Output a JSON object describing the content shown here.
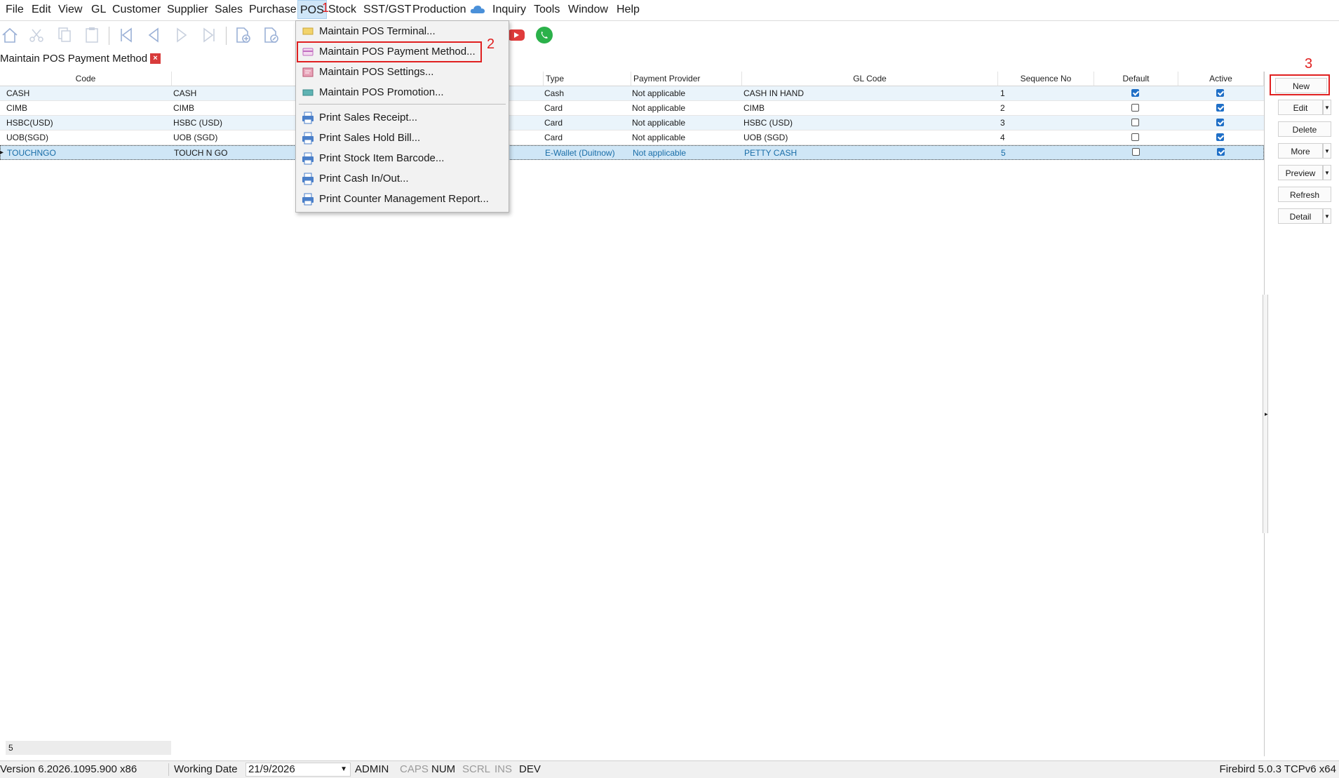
{
  "menu": [
    "File",
    "Edit",
    "View",
    "GL",
    "Customer",
    "Supplier",
    "Sales",
    "Purchase",
    "POS",
    "Stock",
    "SST/GST",
    "Production",
    "Inquiry",
    "Tools",
    "Window",
    "Help"
  ],
  "annotations": {
    "a1": "1",
    "a2": "2",
    "a3": "3"
  },
  "tab": {
    "title": "Maintain POS Payment Method",
    "close": "×"
  },
  "pos_menu": [
    {
      "label": "Maintain POS Terminal...",
      "icon": "terminal-icon"
    },
    {
      "label": "Maintain POS Payment Method...",
      "icon": "payment-card-icon"
    },
    {
      "label": "Maintain POS Settings...",
      "icon": "settings-icon"
    },
    {
      "label": "Maintain POS Promotion...",
      "icon": "promotion-icon"
    },
    {
      "label": "Print Sales Receipt...",
      "icon": "printer-icon"
    },
    {
      "label": "Print Sales Hold Bill...",
      "icon": "printer-icon"
    },
    {
      "label": "Print Stock Item Barcode...",
      "icon": "printer-icon"
    },
    {
      "label": "Print Cash In/Out...",
      "icon": "printer-icon"
    },
    {
      "label": "Print Counter Management Report...",
      "icon": "printer-icon"
    }
  ],
  "grid": {
    "columns": {
      "code": "Code",
      "type": "Type",
      "provider": "Payment Provider",
      "gl": "GL Code",
      "seq": "Sequence No",
      "default": "Default",
      "active": "Active"
    },
    "rows": [
      {
        "code": "CASH",
        "desc": "CASH",
        "type": "Cash",
        "provider": "Not applicable",
        "gl": "CASH IN HAND",
        "seq": "1",
        "default": true,
        "active": true
      },
      {
        "code": "CIMB",
        "desc": "CIMB",
        "type": "Card",
        "provider": "Not applicable",
        "gl": "CIMB",
        "seq": "2",
        "default": false,
        "active": true
      },
      {
        "code": "HSBC(USD)",
        "desc": "HSBC (USD)",
        "type": "Card",
        "provider": "Not applicable",
        "gl": "HSBC (USD)",
        "seq": "3",
        "default": false,
        "active": true
      },
      {
        "code": "UOB(SGD)",
        "desc": "UOB (SGD)",
        "type": "Card",
        "provider": "Not applicable",
        "gl": "UOB (SGD)",
        "seq": "4",
        "default": false,
        "active": true
      },
      {
        "code": "TOUCHNGO",
        "desc": "TOUCH N GO",
        "type": "E-Wallet (Duitnow)",
        "provider": "Not applicable",
        "gl": "PETTY CASH",
        "seq": "5",
        "default": false,
        "active": true
      }
    ],
    "record_count": "5"
  },
  "buttons": {
    "new": "New",
    "edit": "Edit",
    "delete": "Delete",
    "more": "More",
    "preview": "Preview",
    "refresh": "Refresh",
    "detail": "Detail"
  },
  "status": {
    "version": "Version 6.2026.1095.900 x86",
    "working_date_label": "Working Date",
    "working_date": "21/9/2026",
    "user": "ADMIN",
    "caps": "CAPS",
    "num": "NUM",
    "scrl": "SCRL",
    "ins": "INS",
    "dev": "DEV",
    "db": "Firebird 5.0.3 TCPv6 x64"
  },
  "colors": {
    "selection": "#cfe6f6",
    "alt_row": "#eaf4fb",
    "annotation": "#e02020",
    "checkbox": "#1f6fc7"
  }
}
